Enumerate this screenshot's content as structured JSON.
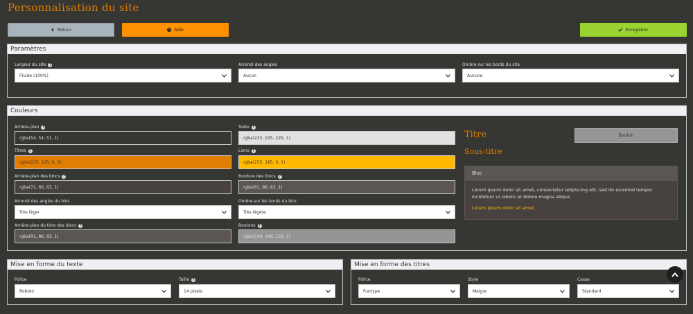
{
  "page_title": "Personnalisation du site",
  "toolbar": {
    "back_label": "Retour",
    "help_label": "Aide",
    "save_label": "Enregistrer"
  },
  "parametres": {
    "title": "Paramètres",
    "width_label": "Largeur du site",
    "width_value": "Fluide (100%)",
    "corners_label": "Arrondi des angles",
    "corners_value": "Aucun",
    "shadow_label": "Ombre sur les bords du site",
    "shadow_value": "Aucune"
  },
  "couleurs": {
    "title": "Couleurs",
    "bg_label": "Arrière-plan",
    "bg_value": "rgba(54, 54, 51, 1)",
    "text_label": "Texte",
    "text_value": "rgba(225, 225, 225, 1)",
    "titles_label": "Titres",
    "titles_value": "rgba(225, 125, 0, 1)",
    "links_label": "Liens",
    "links_value": "rgba(255, 185, 0, 1)",
    "blockbg_label": "Arrière-plan des blocs",
    "blockbg_value": "rgba(71, 66, 63, 1)",
    "blockborder_label": "Bordure des blocs",
    "blockborder_value": "rgba(91, 86, 83, 1)",
    "blockcorner_label": "Arrondi des angles du bloc",
    "blockcorner_value": "Très léger",
    "blockshadow_label": "Ombre sur les bords du bloc",
    "blockshadow_value": "Très légère",
    "blocktitle_label": "Arrière-plan du titre des blocs",
    "blocktitle_value": "rgba(91, 86, 83, 1)",
    "buttons_label": "Boutons",
    "buttons_value": "rgba(149, 149, 150, 1)"
  },
  "preview": {
    "title": "Titre",
    "subtitle": "Sous-titre",
    "button": "Bouton",
    "block_title": "Bloc",
    "block_text": "Lorem ipsum dolor sit amet, consectetur adipiscing elit, sed do eiusmod tempor incididunt ut labore et dolore magna aliqua.",
    "block_link": "Lorem ipsum dolor sit amet."
  },
  "texte": {
    "title": "Mise en forme du texte",
    "font_label": "Police",
    "font_value": "Roboto",
    "size_label": "Taille",
    "size_value": "14 pixels"
  },
  "titres": {
    "title": "Mise en forme des titres",
    "font_label": "Police",
    "font_value": "Funtype",
    "style_label": "Style",
    "style_value": "Maigre",
    "case_label": "Casse",
    "case_value": "Standard"
  },
  "colors": {
    "background": "#363633",
    "accent_title": "#e17d00",
    "accent_link": "#ffb900",
    "save_green": "#9bd331",
    "help_orange": "#ff9100"
  }
}
